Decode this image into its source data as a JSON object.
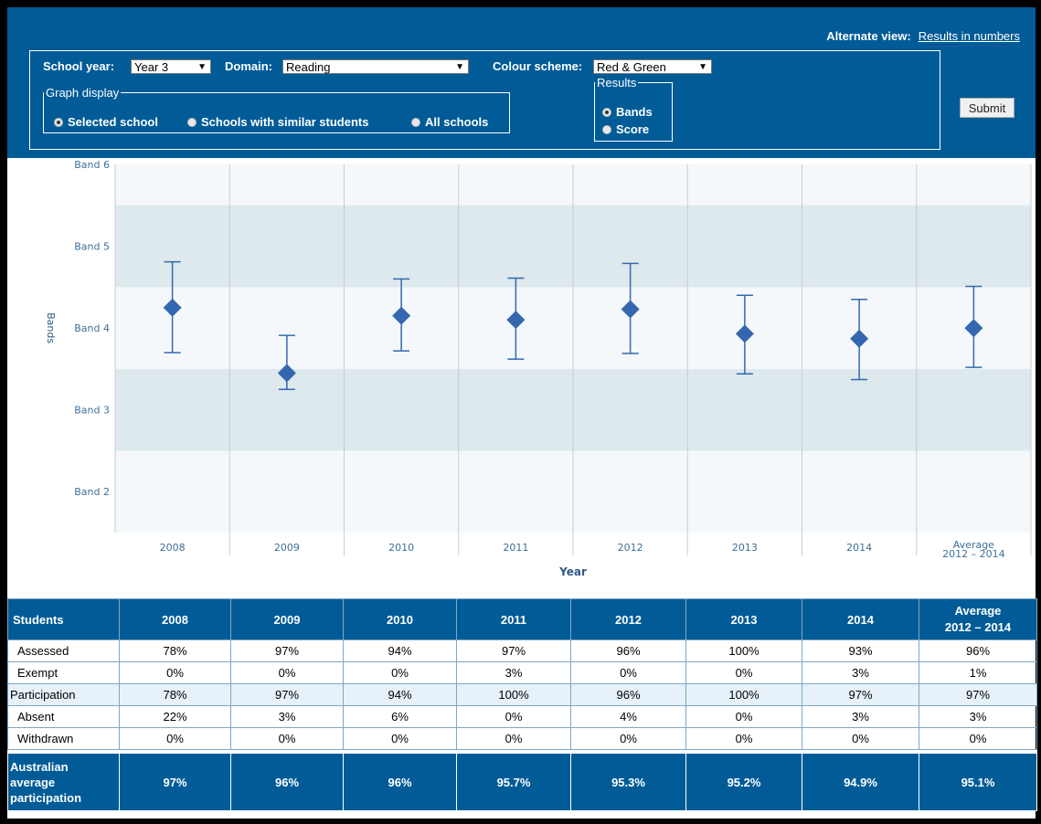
{
  "header": {
    "alternate_view_label": "Alternate view:",
    "alternate_view_link": "Results in numbers",
    "school_year_label": "School year:",
    "school_year_value": "Year 3",
    "domain_label": "Domain:",
    "domain_value": "Reading",
    "colour_scheme_label": "Colour scheme:",
    "colour_scheme_value": "Red & Green",
    "graph_display_legend": "Graph display",
    "graph_display_options": [
      "Selected school",
      "Schools with similar students",
      "All schools"
    ],
    "graph_display_selected": "Selected school",
    "results_legend": "Results",
    "results_options": [
      "Bands",
      "Score"
    ],
    "results_selected": "Bands",
    "submit_label": "Submit",
    "arrow_glyph": "▼"
  },
  "chart_data": {
    "type": "scatter",
    "title": "",
    "xlabel": "Year",
    "ylabel": "Bands",
    "categories": [
      "2008",
      "2009",
      "2010",
      "2011",
      "2012",
      "2013",
      "2014",
      "Average 2012 – 2014"
    ],
    "y_ticks": [
      "Band 2",
      "Band 3",
      "Band 4",
      "Band 5",
      "Band 6"
    ],
    "ylim": [
      1.5,
      6.0
    ],
    "series": [
      {
        "values": [
          4.25,
          3.45,
          4.15,
          4.1,
          4.23,
          3.93,
          3.87,
          4.0
        ],
        "lower": [
          3.7,
          3.25,
          3.72,
          3.62,
          3.69,
          3.44,
          3.37,
          3.52
        ],
        "upper": [
          4.81,
          3.91,
          4.6,
          4.61,
          4.79,
          4.4,
          4.35,
          4.51
        ]
      }
    ],
    "band_shading": [
      {
        "from": 2.5,
        "to": 3.5,
        "color": "#dde9ed"
      },
      {
        "from": 3.5,
        "to": 4.5,
        "color": "#f4f8fa"
      },
      {
        "from": 4.5,
        "to": 5.5,
        "color": "#dde9ed"
      }
    ],
    "colors": {
      "marker": "#3567b0",
      "axis_text": "#3e6f98",
      "grid": "#c7cdd2"
    },
    "grid": true
  },
  "table": {
    "columns": [
      "Students",
      "2008",
      "2009",
      "2010",
      "2011",
      "2012",
      "2013",
      "2014",
      "Average\n2012 – 2014"
    ],
    "rows": [
      {
        "label": "Assessed",
        "values": [
          "78%",
          "97%",
          "94%",
          "97%",
          "96%",
          "100%",
          "93%",
          "96%"
        ]
      },
      {
        "label": "Exempt",
        "values": [
          "0%",
          "0%",
          "0%",
          "3%",
          "0%",
          "0%",
          "3%",
          "1%"
        ]
      },
      {
        "label": "Participation",
        "values": [
          "78%",
          "97%",
          "94%",
          "100%",
          "96%",
          "100%",
          "97%",
          "97%"
        ]
      },
      {
        "label": "Absent",
        "values": [
          "22%",
          "3%",
          "6%",
          "0%",
          "4%",
          "0%",
          "3%",
          "3%"
        ]
      },
      {
        "label": "Withdrawn",
        "values": [
          "0%",
          "0%",
          "0%",
          "0%",
          "0%",
          "0%",
          "0%",
          "0%"
        ]
      }
    ],
    "footer": {
      "label": "Australian\naverage\nparticipation",
      "values": [
        "97%",
        "96%",
        "96%",
        "95.7%",
        "95.3%",
        "95.2%",
        "94.9%",
        "95.1%"
      ]
    }
  }
}
